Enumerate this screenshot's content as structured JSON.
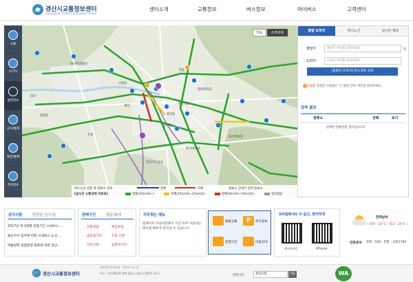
{
  "header": {
    "logo_title": "경산시교통정보센터",
    "logo_subtitle": "Gyeongsan Traffic Information Center",
    "nav": [
      "센터소개",
      "교통정보",
      "버스정보",
      "마이버스",
      "고객센터"
    ]
  },
  "sidebar": {
    "items": [
      "소통",
      "CCTV",
      "돌발정보",
      "공사/통제",
      "돌발/통제",
      "주차정보"
    ]
  },
  "map": {
    "btn_map": "지도",
    "btn_sky": "스카이뷰",
    "labels": [
      "경산시청",
      "대구지방법원",
      "영남대학교",
      "대구대학교",
      "대구한의대",
      "경산역",
      "계양",
      "한국가스공사",
      "대동",
      "정평동",
      "사정동",
      "중방동",
      "유성",
      "대구"
    ],
    "legend": {
      "row1": [
        "버스노선 방향 표 정류소 안내",
        "정체",
        "지체",
        "정류소 안내기 설치 정류소"
      ],
      "row2": [
        "[실시간 소통상태 자료표]",
        "원활(25km/h~)",
        "지체(15km/h~25km/h)",
        "정체(0km/h~15km/h)",
        "정보없음"
      ]
    },
    "colors": {
      "smooth": "#2aa52a",
      "slow": "#f0c419",
      "jam": "#e0281f",
      "none": "#999999",
      "bus": "#1a3fd6"
    }
  },
  "route_panel": {
    "tabs": [
      "출발·도착지",
      "버스노선",
      "실시간 정보"
    ],
    "from_label": "출발지",
    "from_placeholder": "출발지 위치를 입력하세요",
    "to_label": "도착지",
    "to_placeholder": "도착지 위치를 입력하세요",
    "search_button": "[출발지·도착지] 버스경로 검색",
    "notice_label": "도움말",
    "notice_text": "자세한 사용법은 '이 올림 안내' 버튼을 클릭하세요.",
    "results_title": "검색 결과",
    "columns": [
      "정류소",
      "선택",
      "보기"
    ],
    "empty_text": "검색한 정류장을 골라십시니다"
  },
  "notices": {
    "tabs": [
      "공지사항",
      "법원중 선/이설"
    ],
    "items": [
      "2017년 추석명절 연휴기간 시내버스 ...",
      "중산지구 입주에 따른 시내버스 노선...",
      "여름방학 감량운행 중층에 따른 정상..."
    ]
  },
  "traffic_panel": {
    "tabs": [
      "정체구간",
      "돌발/통제"
    ],
    "items": [
      {
        "road": "진량공업",
        "status": "체입유입"
      },
      {
        "road": "금락네거리",
        "status": "허장 시경"
      },
      {
        "road": "하양시청",
        "status": "금락네거리"
      }
    ]
  },
  "menu_panel": {
    "title": "자주찾는 메뉴",
    "desc": "홈페이지 이용자분들이 가장 자주 이용하는 메뉴를 빠르게 찾으실 수 있습니다.",
    "icons": [
      "돌발상황",
      "주차정보",
      "운행시간",
      "이용안내"
    ]
  },
  "mobile_panel": {
    "title": "모바일에서도 더 쉽고, 편리하게",
    "android": "Android",
    "iphone": "iPhone"
  },
  "weather": {
    "title": "현재날씨",
    "temp": "( 최저 : 16°C / 최고 : 26°C )",
    "contact_label": "전화문의",
    "contact": "조회 : 500 · 전화 : 3357760"
  },
  "footer": {
    "title": "경산시교통정보센터",
    "links": "개인정보처리방침 · 찾아오시는 길",
    "address": "주소 : (우)38578 경북 경산시 경산시 청운로 23-3",
    "related_label": "관련기관",
    "related_value": "경산시청",
    "go": "이동",
    "badge": "WA"
  }
}
